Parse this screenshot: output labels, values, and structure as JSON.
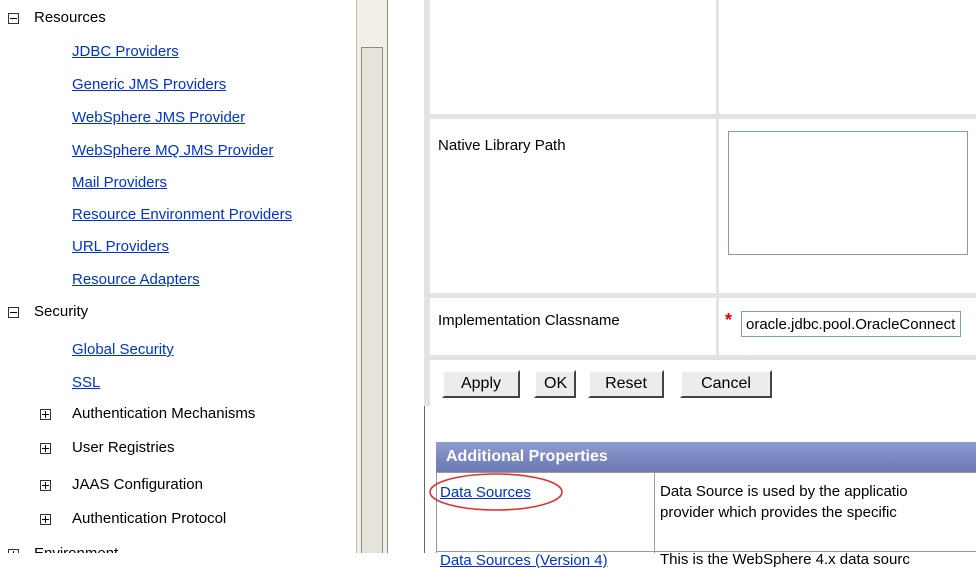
{
  "nav": {
    "resources": {
      "label": "Resources",
      "links": [
        "JDBC Providers",
        "Generic JMS Providers",
        "WebSphere JMS Provider",
        "WebSphere MQ JMS Provider",
        "Mail Providers",
        "Resource Environment Providers",
        "URL Providers",
        "Resource Adapters"
      ]
    },
    "security": {
      "label": "Security",
      "links": [
        "Global Security",
        "SSL"
      ],
      "subcategories": [
        "Authentication Mechanisms",
        "User Registries",
        "JAAS Configuration",
        "Authentication Protocol"
      ]
    },
    "environment_label": "Environment"
  },
  "form": {
    "native_library_path_label": "Native Library Path",
    "native_library_path_value": "",
    "implementation_classname_label": "Implementation Classname",
    "implementation_classname_value": "oracle.jdbc.pool.OracleConnectionPoolDataSource",
    "required_marker": "*",
    "buttons": {
      "apply": "Apply",
      "ok": "OK",
      "reset": "Reset",
      "cancel": "Cancel"
    }
  },
  "additional_properties": {
    "title": "Additional Properties",
    "rows": [
      {
        "link": "Data Sources",
        "description_line1": "Data Source is used by the applicatio",
        "description_line2": "provider which provides the specific"
      },
      {
        "link": "Data Sources (Version 4)",
        "description_line1": "This is the WebSphere 4.x data sourc"
      }
    ]
  },
  "colors": {
    "link": "#0033cc",
    "header_bg": "#7a87c2",
    "annotation_circle": "#e03030",
    "required": "#e00000"
  }
}
